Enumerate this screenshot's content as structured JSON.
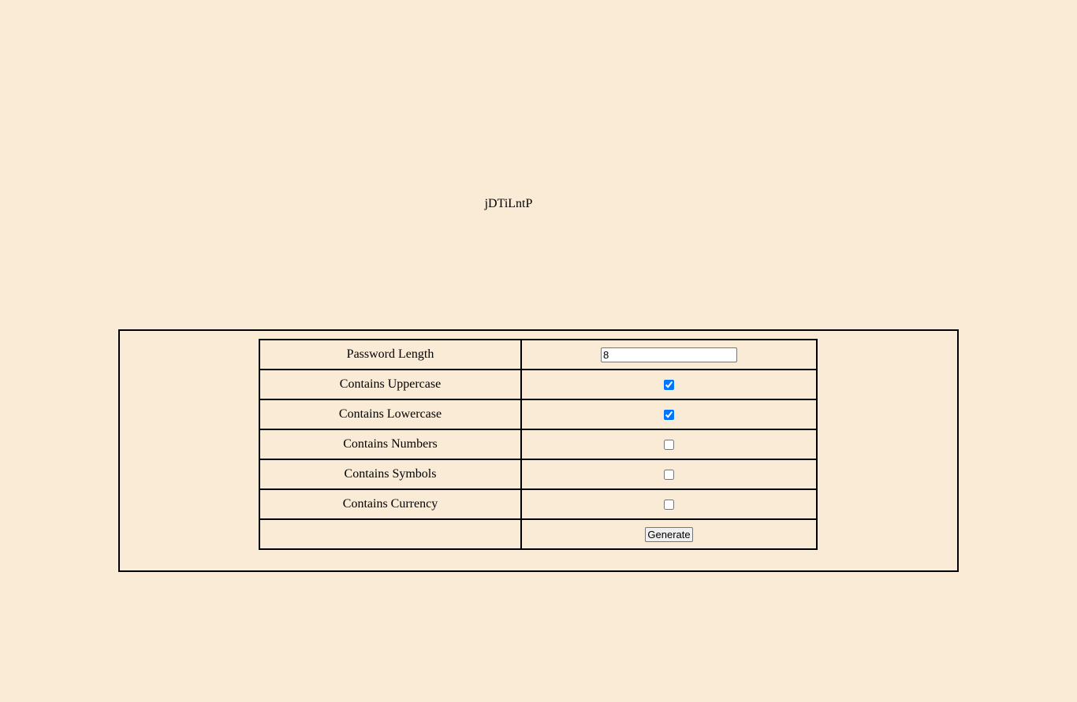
{
  "output": {
    "password": "jDTiLntP"
  },
  "form": {
    "length": {
      "label": "Password Length",
      "value": "8"
    },
    "options": [
      {
        "label": "Contains Uppercase",
        "checked": true
      },
      {
        "label": "Contains Lowercase",
        "checked": true
      },
      {
        "label": "Contains Numbers",
        "checked": false
      },
      {
        "label": "Contains Symbols",
        "checked": false
      },
      {
        "label": "Contains Currency",
        "checked": false
      }
    ],
    "generate_label": "Generate"
  },
  "colors": {
    "background": "#faebd7",
    "checkbox_accent": "#0075ff"
  }
}
